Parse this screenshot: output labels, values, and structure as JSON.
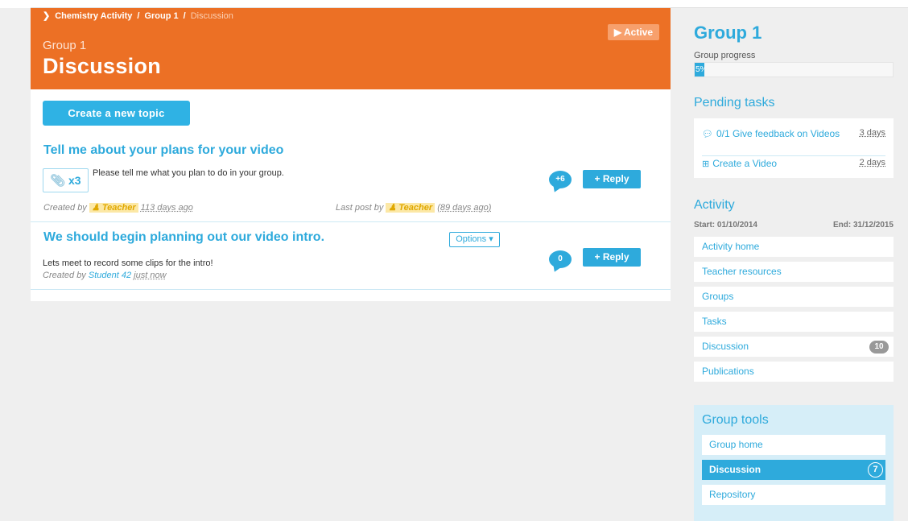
{
  "breadcrumb": {
    "items": [
      "Chemistry Activity",
      "Group 1"
    ],
    "current": "Discussion",
    "separator": "/"
  },
  "header": {
    "subtitle": "Group 1",
    "title": "Discussion",
    "status_badge": "▶ Active",
    "background_color": "#ec7025"
  },
  "main": {
    "new_topic_label": "Create a new topic",
    "topics": [
      {
        "title": "Tell me about your plans for your video",
        "attachment_count": "x3",
        "body": "Please tell me what you plan to do in your group.",
        "created_prefix": "Created by",
        "created_by": "Teacher",
        "created_ago": "113 days ago",
        "last_post_prefix": "Last post by",
        "last_post_by": "Teacher",
        "last_post_ago": "(89 days ago)",
        "reply_count": "+6",
        "reply_label": "+ Reply"
      },
      {
        "title": "We should begin planning out our video intro.",
        "options_label": "Options ▾",
        "body": "Lets meet to record some clips for the intro!",
        "created_prefix": "Created by",
        "created_by": "Student 42",
        "created_ago": "just now",
        "reply_count": "0",
        "reply_label": "+ Reply"
      }
    ]
  },
  "sidebar": {
    "title": "Group 1",
    "progress_label": "Group progress",
    "progress_text": "5%",
    "progress_fraction": 0.05,
    "pending": {
      "heading": "Pending tasks",
      "items": [
        {
          "icon": "comment-icon",
          "label": "0/1 Give feedback on Videos",
          "due": "3 days"
        },
        {
          "icon": "file-plus-icon",
          "label": "Create a Video",
          "due": "2 days"
        }
      ]
    },
    "activity": {
      "heading": "Activity",
      "start": "Start: 01/10/2014",
      "end": "End: 31/12/2015",
      "items": [
        {
          "label": "Activity home"
        },
        {
          "label": "Teacher resources"
        },
        {
          "label": "Groups"
        },
        {
          "label": "Tasks"
        },
        {
          "label": "Discussion",
          "badge": "10"
        },
        {
          "label": "Publications"
        }
      ]
    },
    "tools": {
      "heading": "Group tools",
      "items": [
        {
          "label": "Group home"
        },
        {
          "label": "Discussion",
          "badge": "7",
          "active": true
        },
        {
          "label": "Repository"
        }
      ]
    }
  },
  "colors": {
    "accent": "#2eaadc",
    "orange": "#ec7025",
    "teacher_highlight": "#fce8a6"
  }
}
